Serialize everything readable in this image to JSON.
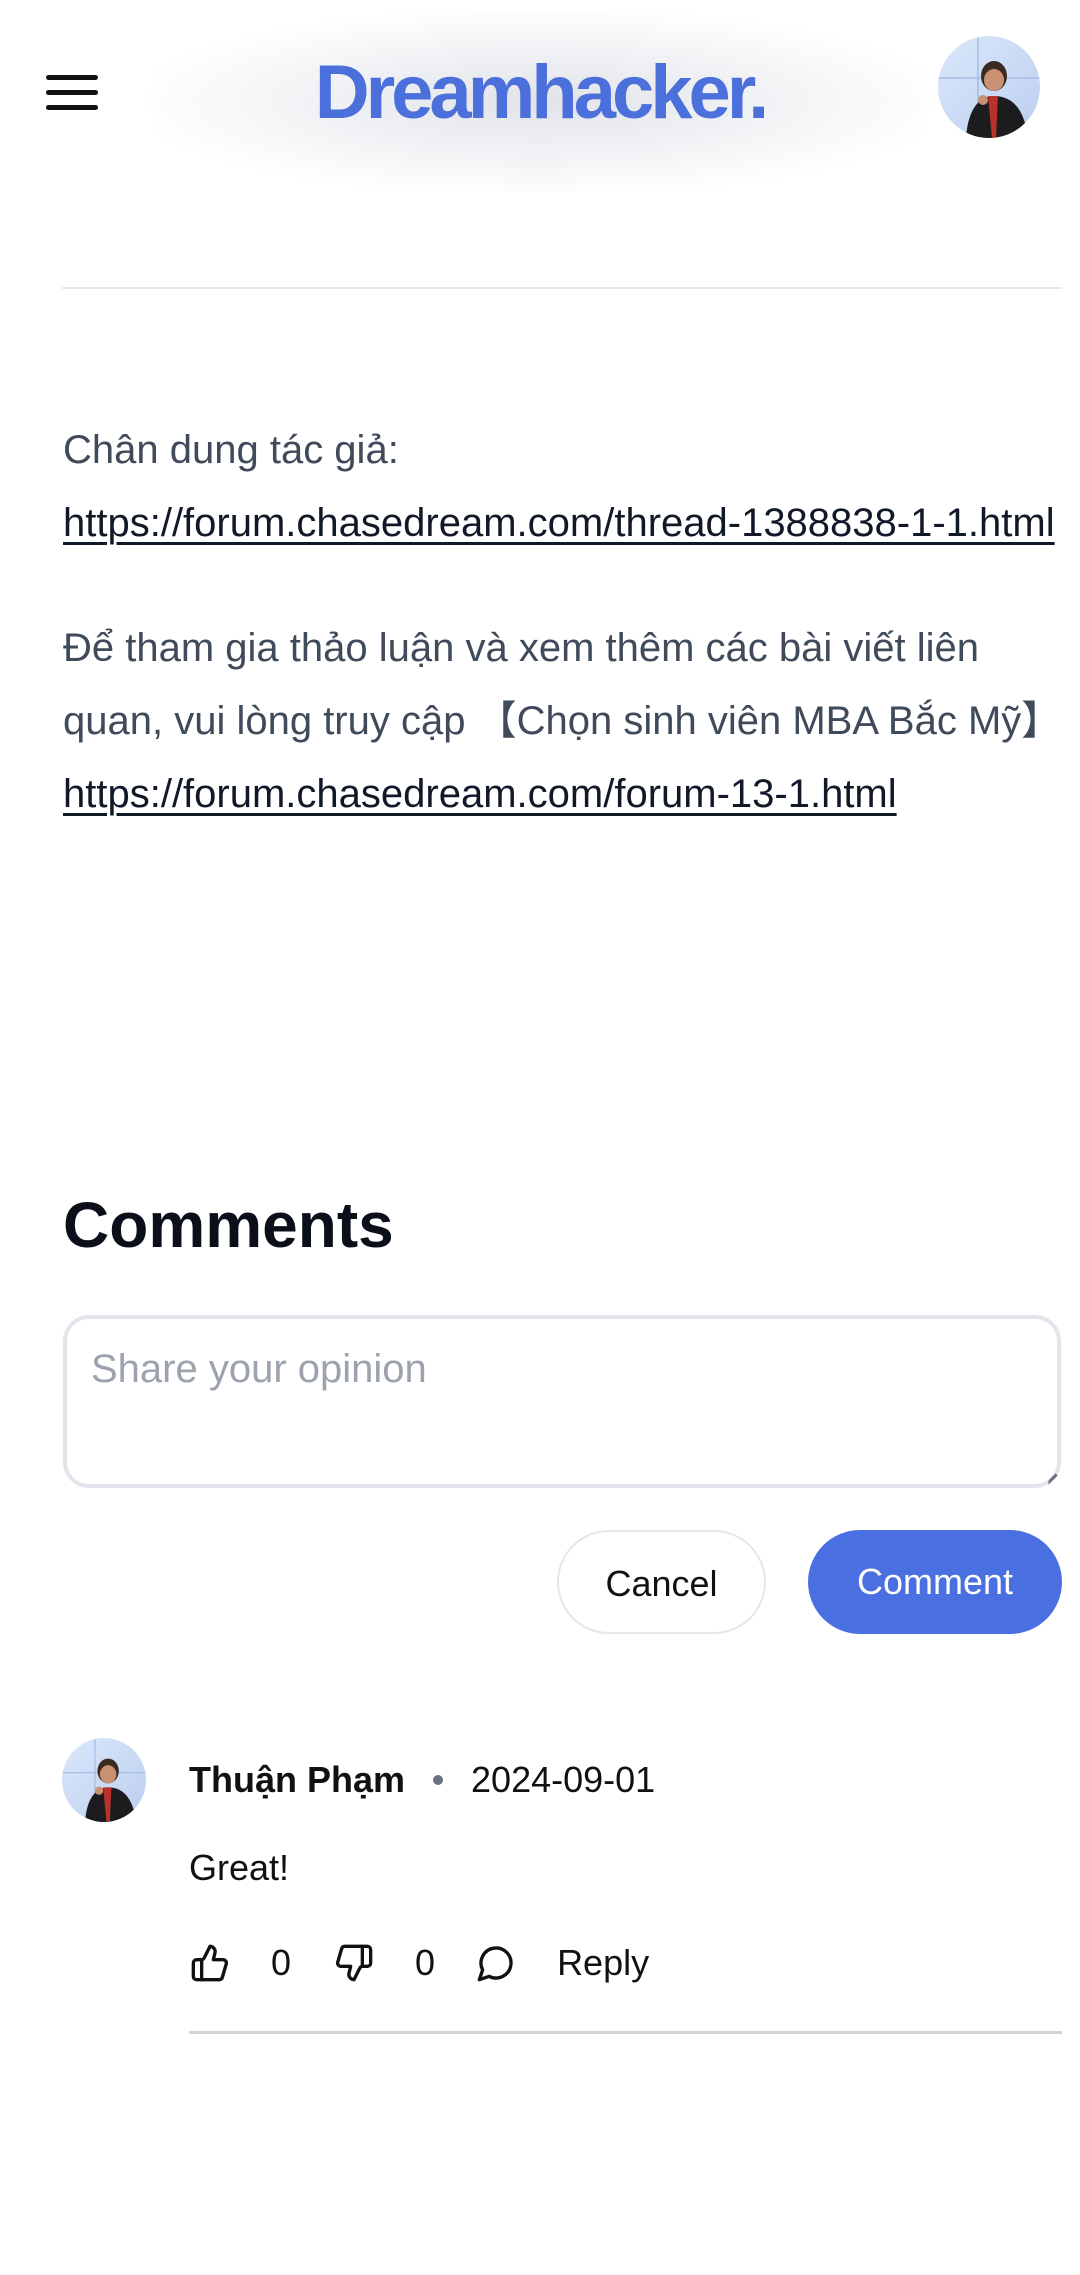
{
  "header": {
    "logo_text": "Dreamhacker.",
    "logo_color": "#4b6fdb",
    "menu_icon": "hamburger-menu-icon",
    "profile_avatar": "user-avatar"
  },
  "article": {
    "paragraph1_text": "Chân dung tác giả:",
    "paragraph1_link": "https://forum.chasedream.com/thread-1388838-1-1.html",
    "paragraph2_text": "Để tham gia thảo luận và xem thêm các bài viết liên quan, vui lòng truy cập 【Chọn sinh viên MBA Bắc Mỹ】",
    "paragraph2_link": "https://forum.chasedream.com/forum-13-1.html"
  },
  "comments": {
    "heading": "Comments",
    "input_placeholder": "Share your opinion",
    "input_value": "",
    "cancel_label": "Cancel",
    "submit_label": "Comment",
    "accent_color": "#4a6fe1",
    "items": [
      {
        "author": "Thuận Phạm",
        "date": "2024-09-01",
        "body": "Great!",
        "likes": "0",
        "dislikes": "0",
        "reply_label": "Reply"
      }
    ]
  }
}
